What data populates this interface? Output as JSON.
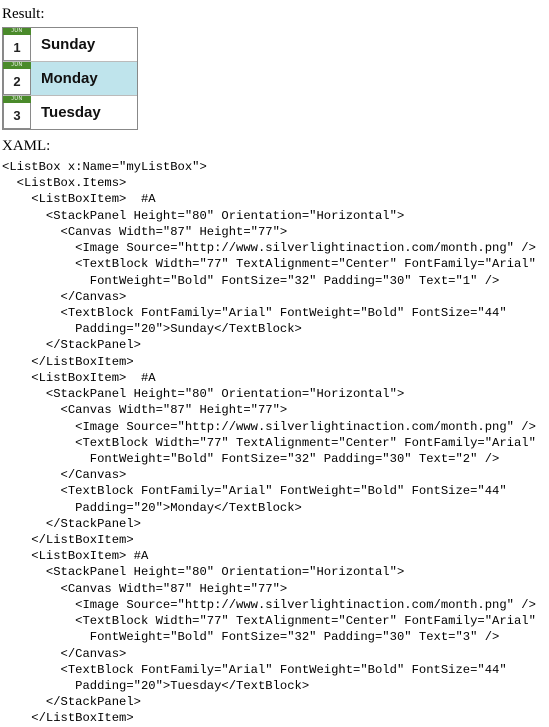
{
  "labels": {
    "result": "Result:",
    "xaml": "XAML:"
  },
  "listbox": {
    "month_label": "JUN",
    "items": [
      {
        "num": "1",
        "name": "Sunday",
        "selected": false
      },
      {
        "num": "2",
        "name": "Monday",
        "selected": true
      },
      {
        "num": "3",
        "name": "Tuesday",
        "selected": false
      }
    ]
  },
  "code_lines": [
    "<ListBox x:Name=\"myListBox\">",
    "  <ListBox.Items>",
    "    <ListBoxItem>  #A",
    "      <StackPanel Height=\"80\" Orientation=\"Horizontal\">",
    "        <Canvas Width=\"87\" Height=\"77\">",
    "          <Image Source=\"http://www.silverlightinaction.com/month.png\" />",
    "          <TextBlock Width=\"77\" TextAlignment=\"Center\" FontFamily=\"Arial\"",
    "            FontWeight=\"Bold\" FontSize=\"32\" Padding=\"30\" Text=\"1\" />",
    "        </Canvas>",
    "        <TextBlock FontFamily=\"Arial\" FontWeight=\"Bold\" FontSize=\"44\"",
    "          Padding=\"20\">Sunday</TextBlock>",
    "      </StackPanel>",
    "    </ListBoxItem>",
    "    <ListBoxItem>  #A",
    "      <StackPanel Height=\"80\" Orientation=\"Horizontal\">",
    "        <Canvas Width=\"87\" Height=\"77\">",
    "          <Image Source=\"http://www.silverlightinaction.com/month.png\" />",
    "          <TextBlock Width=\"77\" TextAlignment=\"Center\" FontFamily=\"Arial\"",
    "            FontWeight=\"Bold\" FontSize=\"32\" Padding=\"30\" Text=\"2\" />",
    "        </Canvas>",
    "        <TextBlock FontFamily=\"Arial\" FontWeight=\"Bold\" FontSize=\"44\"",
    "          Padding=\"20\">Monday</TextBlock>",
    "      </StackPanel>",
    "    </ListBoxItem>",
    "    <ListBoxItem> #A",
    "      <StackPanel Height=\"80\" Orientation=\"Horizontal\">",
    "        <Canvas Width=\"87\" Height=\"77\">",
    "          <Image Source=\"http://www.silverlightinaction.com/month.png\" />",
    "          <TextBlock Width=\"77\" TextAlignment=\"Center\" FontFamily=\"Arial\"",
    "            FontWeight=\"Bold\" FontSize=\"32\" Padding=\"30\" Text=\"3\" />",
    "        </Canvas>",
    "        <TextBlock FontFamily=\"Arial\" FontWeight=\"Bold\" FontSize=\"44\"",
    "          Padding=\"20\">Tuesday</TextBlock>",
    "      </StackPanel>",
    "    </ListBoxItem>"
  ]
}
